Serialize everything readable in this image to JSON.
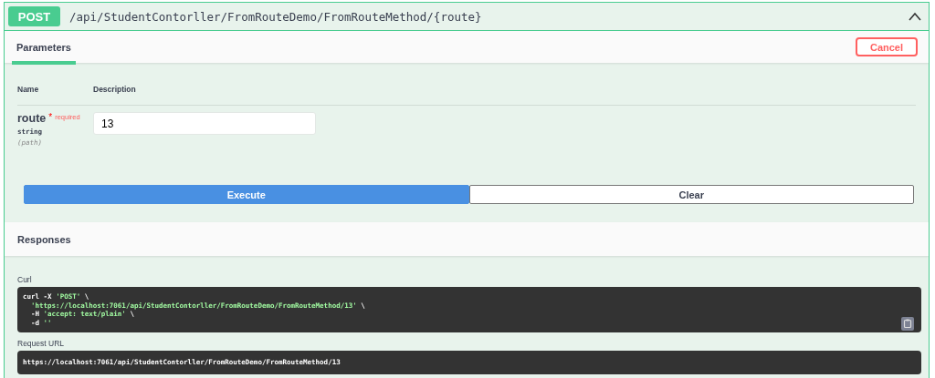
{
  "operation": {
    "method": "POST",
    "path": "/api/StudentContorller/FromRouteDemo/FromRouteMethod/{route}",
    "expanded": true
  },
  "tabs": [
    {
      "label": "Parameters",
      "selected": true
    }
  ],
  "cancel_button": "Cancel",
  "parameters": {
    "columns": [
      "Name",
      "Description"
    ],
    "rows": [
      {
        "name": "route",
        "required_mark": "*",
        "required_label": "required",
        "type": "string",
        "location": "(path)",
        "value": "13"
      }
    ]
  },
  "actions": [
    {
      "label": "Execute",
      "kind": "primary"
    },
    {
      "label": "Clear",
      "kind": "secondary"
    }
  ],
  "responses": {
    "title": "Responses",
    "curl_label": "Curl",
    "curl_lines": [
      [
        {
          "text": "curl -X ",
          "kind": "plain"
        },
        {
          "text": "'POST'",
          "kind": "string"
        },
        {
          "text": " \\",
          "kind": "plain"
        }
      ],
      [
        {
          "text": "  'https://localhost:7061/api/StudentContorller/FromRouteDemo/FromRouteMethod/13'",
          "kind": "string"
        },
        {
          "text": " \\",
          "kind": "plain"
        }
      ],
      [
        {
          "text": "  -H ",
          "kind": "plain"
        },
        {
          "text": "'accept: text/plain'",
          "kind": "string"
        },
        {
          "text": " \\",
          "kind": "plain"
        }
      ],
      [
        {
          "text": "  -d ",
          "kind": "plain"
        },
        {
          "text": "''",
          "kind": "string"
        }
      ]
    ],
    "request_url_label": "Request URL",
    "request_url": "https://localhost:7061/api/StudentContorller/FromRouteDemo/FromRouteMethod/13"
  }
}
